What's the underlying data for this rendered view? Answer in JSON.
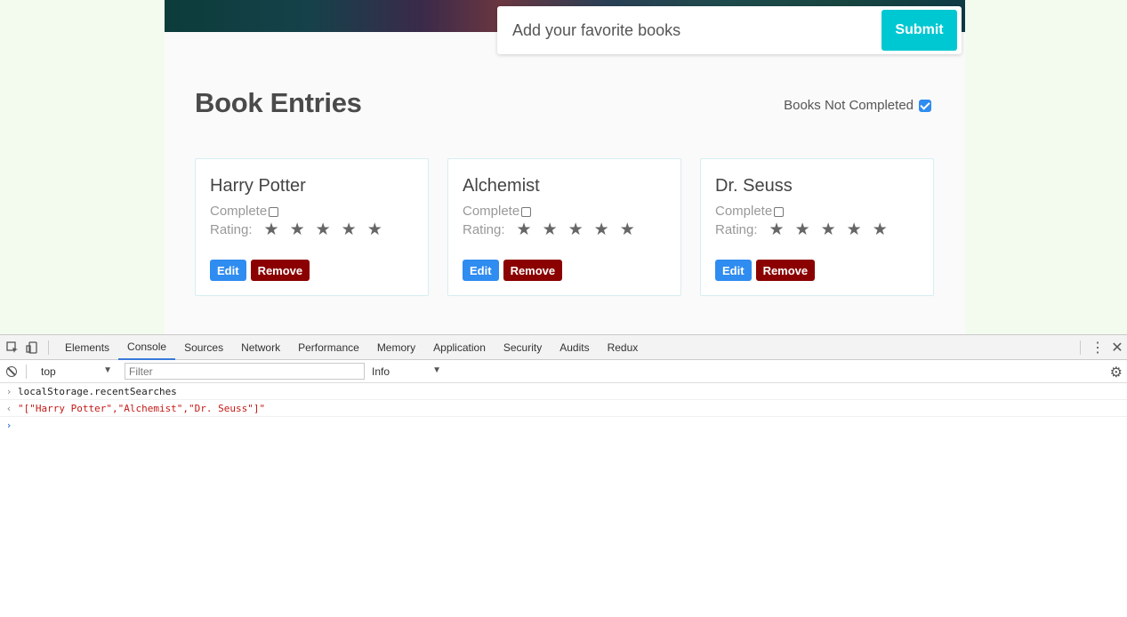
{
  "app": {
    "search": {
      "placeholder": "Add your favorite books",
      "submit_label": "Submit"
    },
    "page_title": "Book Entries",
    "filter": {
      "label": "Books Not Completed",
      "checked": true
    },
    "books": [
      {
        "title": "Harry Potter",
        "complete_label": "Complete",
        "rating_label": "Rating:",
        "stars": "★★★★★",
        "edit_label": "Edit",
        "remove_label": "Remove"
      },
      {
        "title": "Alchemist",
        "complete_label": "Complete",
        "rating_label": "Rating:",
        "stars": "★★★★★",
        "edit_label": "Edit",
        "remove_label": "Remove"
      },
      {
        "title": "Dr. Seuss",
        "complete_label": "Complete",
        "rating_label": "Rating:",
        "stars": "★★★★★",
        "edit_label": "Edit",
        "remove_label": "Remove"
      }
    ],
    "colors": {
      "submit": "#00c8d2",
      "edit": "#2f8cf0",
      "remove": "#8b0000"
    }
  },
  "devtools": {
    "tabs": [
      "Elements",
      "Console",
      "Sources",
      "Network",
      "Performance",
      "Memory",
      "Application",
      "Security",
      "Audits",
      "Redux"
    ],
    "active_tab": "Console",
    "context": "top",
    "filter_placeholder": "Filter",
    "level": "Info",
    "console": {
      "input": "localStorage.recentSearches",
      "output": "\"[\"Harry Potter\",\"Alchemist\",\"Dr. Seuss\"]\""
    },
    "icons": {
      "inspect": "inspect-element-icon",
      "device": "device-toolbar-icon",
      "more": "kebab-menu-icon",
      "close": "close-icon",
      "clear": "clear-console-icon",
      "settings": "gear-icon"
    }
  }
}
